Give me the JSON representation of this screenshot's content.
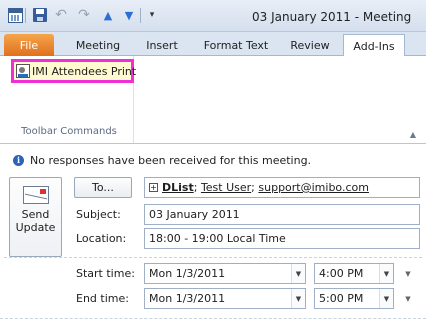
{
  "window": {
    "title": "03 January 2011  -  Meeting"
  },
  "quick_access": {
    "icons": [
      "calendar-app-icon",
      "save-icon",
      "undo-icon",
      "redo-icon",
      "up-icon",
      "down-icon",
      "customize-icon"
    ],
    "undo_glyph": "↶",
    "redo_glyph": "↷",
    "up_glyph": "▲",
    "down_glyph": "▼",
    "customize_glyph": "▾"
  },
  "tabs": [
    {
      "label": "File"
    },
    {
      "label": "Meeting"
    },
    {
      "label": "Insert"
    },
    {
      "label": "Format Text"
    },
    {
      "label": "Review"
    },
    {
      "label": "Add-Ins",
      "active": true
    }
  ],
  "ribbon": {
    "command_label": "IMI Attendees Print",
    "group_label": "Toolbar Commands",
    "collapse_glyph": "▲"
  },
  "form": {
    "info_message": "No responses have been received for this meeting.",
    "info_glyph": "i",
    "send_label_line1": "Send",
    "send_label_line2": "Update",
    "to_button": "To...",
    "to_expand_glyph": "+",
    "to_dlist": "DList",
    "to_sep1": ";",
    "to_user": "Test User",
    "to_sep2": ";",
    "to_email": "support@imibo.com",
    "subject_label": "Subject:",
    "subject_value": "03 January 2011",
    "location_label": "Location:",
    "location_value": "18:00 - 19:00 Local Time",
    "start_label": "Start time:",
    "start_date": "Mon 1/3/2011",
    "start_time": "4:00 PM",
    "end_label": "End time:",
    "end_date": "Mon 1/3/2011",
    "end_time": "5:00 PM",
    "dropdown_glyph": "▼"
  },
  "colors": {
    "file_tab": "#e0701e",
    "highlight_border": "#f030d6",
    "info_icon": "#2b63b8"
  }
}
